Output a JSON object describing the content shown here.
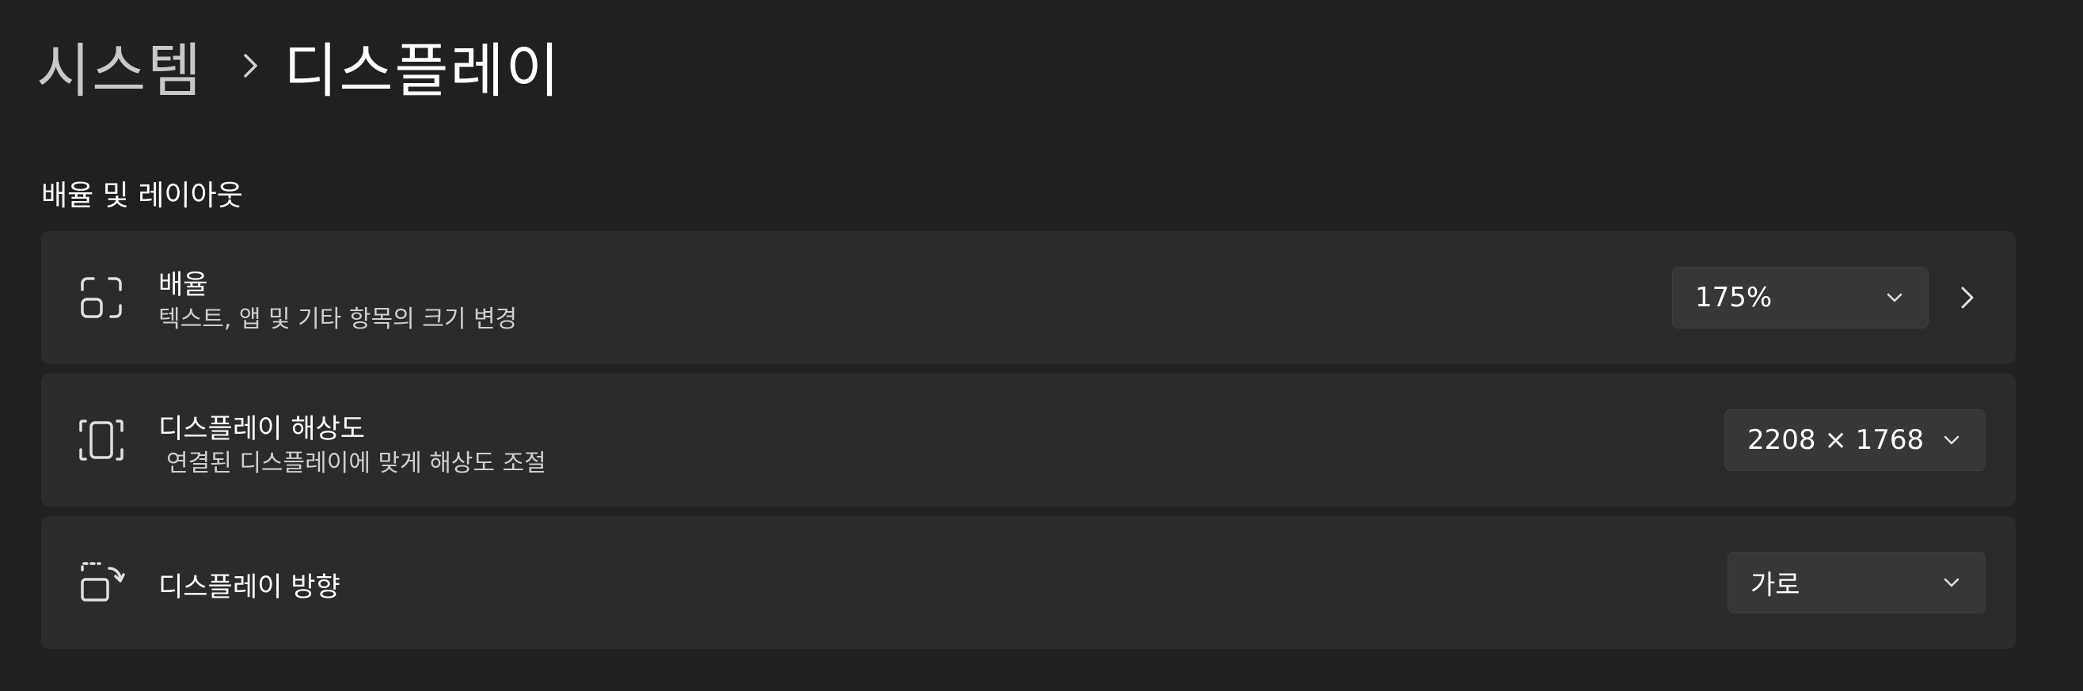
{
  "breadcrumb": {
    "parent": "시스템",
    "separator_icon": "chevron-right-icon",
    "current": "디스플레이"
  },
  "section": {
    "title": "배율 및 레이아웃"
  },
  "cards": [
    {
      "title": "배율",
      "description": "텍스트, 앱 및 기타 항목의 크기 변경",
      "icon": "scale-icon",
      "dropdown_value": "175%",
      "has_chevron": true
    },
    {
      "title": "디스플레이 해상도",
      "description": "연결된 디스플레이에 맞게 해상도 조절",
      "icon": "resolution-icon",
      "dropdown_value": "2208 × 1768",
      "has_chevron": false
    },
    {
      "title": "디스플레이 방향",
      "icon": "orientation-icon",
      "dropdown_value": "가로",
      "has_chevron": false
    }
  ],
  "colors": {
    "background": "#202020",
    "card": "#2b2b2b",
    "dropdown": "#373737",
    "text_primary": "#ffffff",
    "text_secondary": "#cfcfcf"
  }
}
